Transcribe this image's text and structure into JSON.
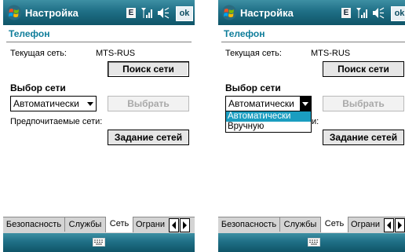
{
  "colors": {
    "accent": "#0e7d9a",
    "titlebar": "#1f6f86",
    "highlight": "#1a9dc0"
  },
  "screens": [
    {
      "title": "Настройка",
      "icons": {
        "e": "E"
      },
      "ok_label": "ok",
      "page_title": "Телефон",
      "current_network_label": "Текущая сеть:",
      "current_network_value": "MTS-RUS",
      "search_button": "Поиск сети",
      "network_select_label": "Выбор сети",
      "mode_value": "Автоматически",
      "select_button": "Выбрать",
      "preferred_label": "Предпочитаемые сети:",
      "set_networks_button": "Задание сетей",
      "tabs": [
        "Безопасность",
        "Службы",
        "Сеть",
        "Ограни"
      ],
      "active_tab": "Сеть"
    },
    {
      "title": "Настройка",
      "icons": {
        "e": "E"
      },
      "ok_label": "ok",
      "page_title": "Телефон",
      "current_network_label": "Текущая сеть:",
      "current_network_value": "MTS-RUS",
      "search_button": "Поиск сети",
      "network_select_label": "Выбор сети",
      "mode_value": "Автоматически",
      "select_button": "Выбрать",
      "preferred_label_tail": "и:",
      "set_networks_button": "Задание сетей",
      "dropdown_options": [
        "Автоматически",
        "Вручную"
      ],
      "dropdown_selected": "Автоматически",
      "tabs": [
        "Безопасность",
        "Службы",
        "Сеть",
        "Ограни"
      ],
      "active_tab": "Сеть"
    }
  ]
}
